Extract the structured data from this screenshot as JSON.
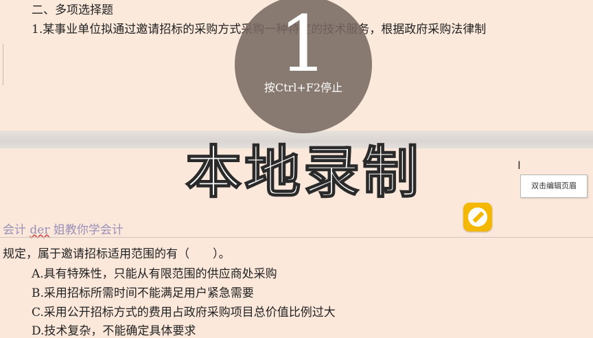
{
  "document": {
    "section_heading": "二、多项选择题",
    "question_line1": "1.某事业单位拟通过邀请招标的采购方式采购一种特定的技术服务，根据政府采购法律制",
    "question_line2": "规定，属于邀请招标适用范围的有（　　）。",
    "options": [
      "A.具有特殊性，只能从有限范围的供应商处采购",
      "B.采用招标所需时间不能满足用户紧急需要",
      "C.采用公开招标方式的费用占政府采购项目总价值比例过大",
      "D.技术复杂，不能确定具体要求"
    ],
    "header_text_part1": "会计 ",
    "header_text_underlined": "der",
    "header_text_part2": " 姐教你学会计",
    "header_tooltip": "双击编辑页眉"
  },
  "recorder": {
    "countdown": "1",
    "hint": "按Ctrl+F2停止",
    "title": "本地录制"
  },
  "icons": {
    "pencil": "pencil-edit-icon",
    "cursor": "text-cursor-icon"
  },
  "colors": {
    "page_bg": "#fbe8db",
    "accent_yellow": "#f5b800",
    "watermark_purple": "#9a8fb6"
  }
}
